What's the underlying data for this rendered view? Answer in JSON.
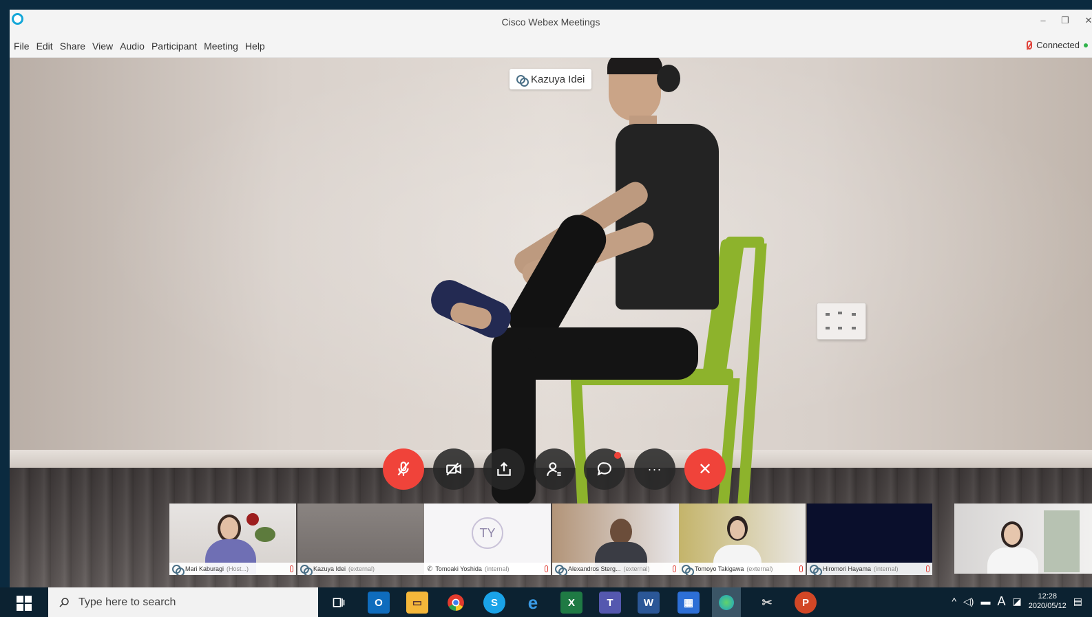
{
  "window": {
    "title": "Cisco Webex Meetings",
    "minimize_glyph": "–",
    "restore_glyph": "❐",
    "close_glyph": "✕"
  },
  "menu": [
    {
      "label": "File"
    },
    {
      "label": "Edit"
    },
    {
      "label": "Share"
    },
    {
      "label": "View"
    },
    {
      "label": "Audio"
    },
    {
      "label": "Participant"
    },
    {
      "label": "Meeting"
    },
    {
      "label": "Help"
    }
  ],
  "status": {
    "connection": "Connected",
    "status_color": "#2fb34a"
  },
  "active_speaker": {
    "name": "Kazuya Idei"
  },
  "controls": [
    {
      "name": "mute-button",
      "icon": "microphone-muted-icon"
    },
    {
      "name": "video-button",
      "icon": "camera-off-icon"
    },
    {
      "name": "share-button",
      "icon": "share-icon"
    },
    {
      "name": "participants-button",
      "icon": "participants-icon"
    },
    {
      "name": "chat-button",
      "icon": "chat-icon"
    },
    {
      "name": "more-options-button",
      "icon": "more-icon",
      "glyph": "···"
    },
    {
      "name": "leave-meeting-button",
      "icon": "close-icon",
      "glyph": "✕"
    }
  ],
  "participants": [
    {
      "name": "Mari Kaburagi",
      "tag": "(Host...)"
    },
    {
      "name": "Kazuya Idei",
      "tag": "(external)"
    },
    {
      "name": "Tomoaki Yoshida",
      "tag": "(internal)",
      "initials": "TY"
    },
    {
      "name": "Alexandros Sterg...",
      "tag": "(external)"
    },
    {
      "name": "Tomoyo Takigawa",
      "tag": "(external)"
    },
    {
      "name": "Hiromori Hayama",
      "tag": "(internal)"
    },
    {
      "name": "",
      "tag": ""
    }
  ],
  "taskbar": {
    "search_placeholder": "Type here to search",
    "time": "12:28",
    "date": "2020/05/12",
    "ime_label": "A",
    "apps": [
      "outlook-icon",
      "file-explorer-icon",
      "chrome-icon",
      "skype-icon",
      "edge-icon",
      "excel-icon",
      "teams-icon",
      "word-icon",
      "calendar-icon",
      "webex-icon",
      "snipping-icon",
      "powerpoint-icon"
    ]
  },
  "colors": {
    "accent_red": "#f0433a",
    "chair_green": "#8db32c",
    "taskbar": "#0c2231"
  }
}
